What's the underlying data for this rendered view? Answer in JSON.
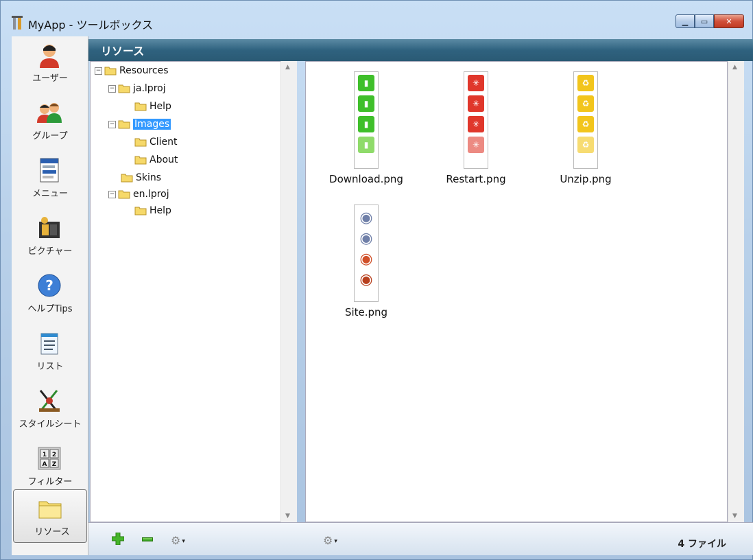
{
  "window": {
    "title": "MyApp - ツールボックス",
    "min_glyph": "▁",
    "max_glyph": "▭",
    "close_glyph": "✕"
  },
  "sidebar": {
    "items": [
      {
        "label": "ユーザー",
        "icon": "user-icon"
      },
      {
        "label": "グループ",
        "icon": "group-icon"
      },
      {
        "label": "メニュー",
        "icon": "menu-icon"
      },
      {
        "label": "ピクチャー",
        "icon": "picture-icon"
      },
      {
        "label": "ヘルプTips",
        "icon": "help-icon"
      },
      {
        "label": "リスト",
        "icon": "list-icon"
      },
      {
        "label": "スタイルシート",
        "icon": "stylesheet-icon"
      },
      {
        "label": "フィルター",
        "icon": "filter-icon"
      },
      {
        "label": "リソース",
        "icon": "folder-icon"
      }
    ],
    "active_index": 8
  },
  "header": {
    "title": "リソース"
  },
  "tree": {
    "items": [
      {
        "label": "Resources",
        "expander": "⊟"
      },
      {
        "label": "ja.lproj",
        "expander": "⊟"
      },
      {
        "label": "Help",
        "expander": ""
      },
      {
        "label": "Images",
        "expander": "⊟"
      },
      {
        "label": "Client",
        "expander": ""
      },
      {
        "label": "About",
        "expander": ""
      },
      {
        "label": "Skins",
        "expander": ""
      },
      {
        "label": "en.lproj",
        "expander": "⊟"
      },
      {
        "label": "Help",
        "expander": ""
      }
    ],
    "selected": "Images"
  },
  "files": [
    {
      "name": "Download.png",
      "color": "#3fbf2a",
      "glyph": "▮"
    },
    {
      "name": "Restart.png",
      "color": "#e0372b",
      "glyph": "✳"
    },
    {
      "name": "Unzip.png",
      "color": "#f2c51c",
      "glyph": "♻"
    },
    {
      "name": "Site.png",
      "color": "#6f7fa8",
      "glyph": "◉"
    }
  ],
  "footer": {
    "add_glyph": "✚",
    "gear_glyph": "⚙",
    "caret_glyph": "▾",
    "file_count": "4 ファイル"
  },
  "colors": {
    "header_bg": "#2f627f",
    "selection": "#3399ff"
  }
}
